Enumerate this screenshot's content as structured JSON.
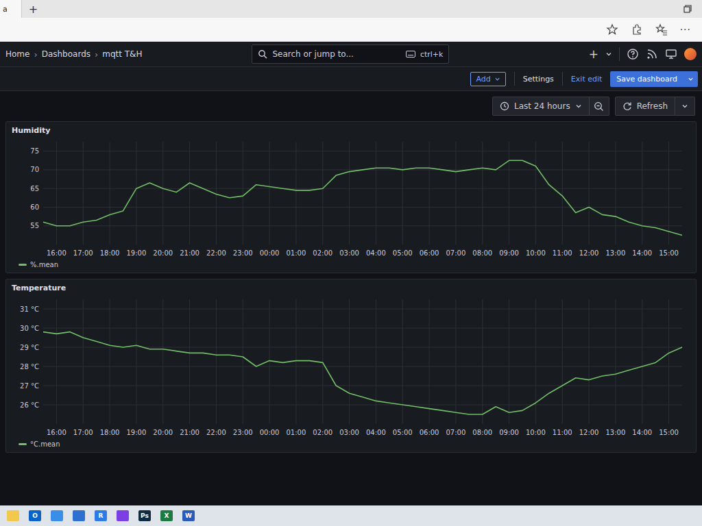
{
  "browser": {
    "tab_title": "a",
    "new_tab": "+",
    "menu": "···"
  },
  "header": {
    "breadcrumbs": [
      {
        "label": "Home"
      },
      {
        "label": "Dashboards"
      },
      {
        "label": "mqtt T&H"
      }
    ],
    "separator": "›",
    "search": {
      "placeholder": "Search or jump to...",
      "shortcut": "ctrl+k"
    },
    "new": "+"
  },
  "edit_bar": {
    "add": "Add",
    "settings": "Settings",
    "exit": "Exit edit",
    "save": "Save dashboard"
  },
  "time_picker": {
    "range": "Last 24 hours",
    "refresh": "Refresh"
  },
  "panels": [
    {
      "title": "Humidity",
      "legend": "%.mean",
      "y_ticks": [
        "55",
        "60",
        "65",
        "70",
        "75"
      ],
      "x_ticks": [
        "16:00",
        "17:00",
        "18:00",
        "19:00",
        "20:00",
        "21:00",
        "22:00",
        "23:00",
        "00:00",
        "01:00",
        "02:00",
        "03:00",
        "04:00",
        "05:00",
        "06:00",
        "07:00",
        "08:00",
        "09:00",
        "10:00",
        "11:00",
        "12:00",
        "13:00",
        "14:00",
        "15:00"
      ],
      "values": [
        56,
        55,
        55,
        56,
        56.5,
        58,
        59,
        65,
        66.5,
        65,
        64,
        66.5,
        65,
        63.5,
        62.5,
        63,
        66,
        65.5,
        65,
        64.5,
        64.5,
        65,
        68.5,
        69.5,
        70,
        70.5,
        70.5,
        70,
        70.5,
        70.5,
        70,
        69.5,
        70,
        70.5,
        70,
        72.5,
        72.5,
        71,
        66,
        63,
        58.5,
        60,
        58,
        57.5,
        56,
        55,
        54.5,
        53.5,
        52.5
      ]
    },
    {
      "title": "Temperature",
      "legend": "°C.mean",
      "y_ticks": [
        "26 °C",
        "27 °C",
        "28 °C",
        "29 °C",
        "30 °C",
        "31 °C"
      ],
      "x_ticks": [
        "16:00",
        "17:00",
        "18:00",
        "19:00",
        "20:00",
        "21:00",
        "22:00",
        "23:00",
        "00:00",
        "01:00",
        "02:00",
        "03:00",
        "04:00",
        "05:00",
        "06:00",
        "07:00",
        "08:00",
        "09:00",
        "10:00",
        "11:00",
        "12:00",
        "13:00",
        "14:00",
        "15:00"
      ],
      "values": [
        29.8,
        29.7,
        29.8,
        29.5,
        29.3,
        29.1,
        29.0,
        29.1,
        28.9,
        28.9,
        28.8,
        28.7,
        28.7,
        28.6,
        28.6,
        28.5,
        28.0,
        28.3,
        28.2,
        28.3,
        28.3,
        28.2,
        27.0,
        26.6,
        26.4,
        26.2,
        26.1,
        26.0,
        25.9,
        25.8,
        25.7,
        25.6,
        25.5,
        25.5,
        25.9,
        25.6,
        25.7,
        26.1,
        26.6,
        27.0,
        27.4,
        27.3,
        27.5,
        27.6,
        27.8,
        28.0,
        28.2,
        28.7,
        29.0
      ]
    }
  ],
  "taskbar": [
    {
      "label": "",
      "color": "#f2c94c"
    },
    {
      "label": "O",
      "color": "#0a64c8"
    },
    {
      "label": "",
      "color": "#3b8ee8"
    },
    {
      "label": "",
      "color": "#2f6fd1"
    },
    {
      "label": "R",
      "color": "#2d7be5"
    },
    {
      "label": "",
      "color": "#7b3fe4"
    },
    {
      "label": "Ps",
      "color": "#0f2a44"
    },
    {
      "label": "X",
      "color": "#1d7a45"
    },
    {
      "label": "W",
      "color": "#2b5bb8"
    }
  ]
}
